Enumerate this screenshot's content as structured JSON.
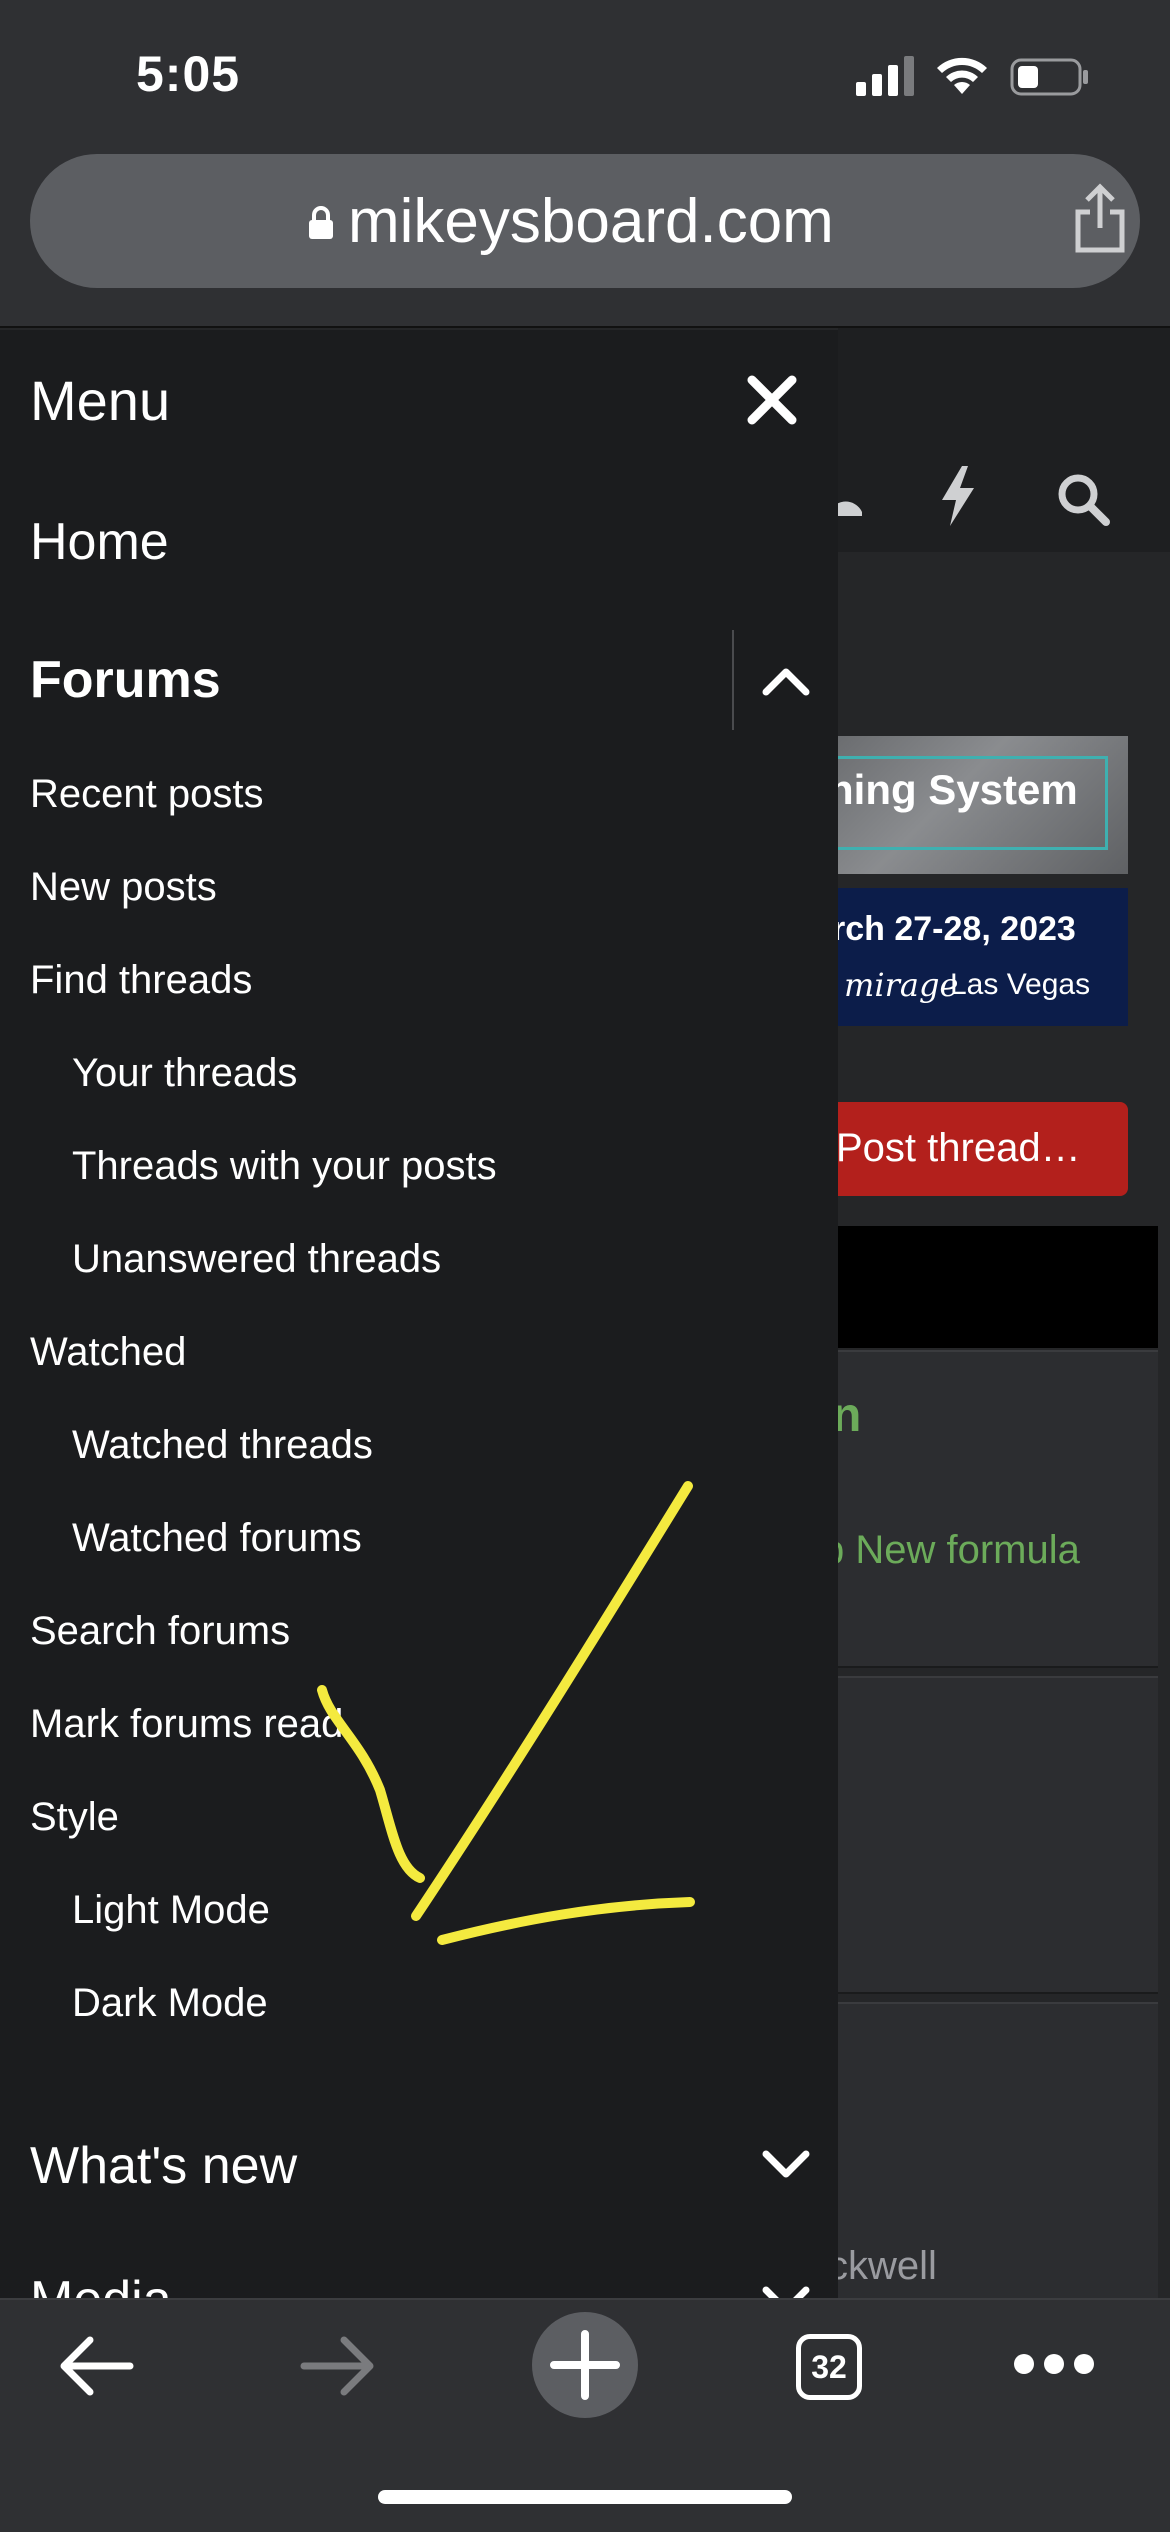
{
  "status": {
    "time": "5:05"
  },
  "browser": {
    "url": "mikeysboard.com",
    "tab_count": "32"
  },
  "background_page": {
    "banner1_text": "ning System",
    "banner2_line1": "rch 27-28, 2023",
    "banner2_line2": "Las Vegas",
    "banner2_logo": "mirage",
    "post_thread_button": "Post thread…",
    "card1_title_fragment": "n",
    "card1_text": "p New formula",
    "card3_text": "ckwell"
  },
  "menu": {
    "title": "Menu",
    "home": "Home",
    "forums": "Forums",
    "items": {
      "recent_posts": "Recent posts",
      "new_posts": "New posts",
      "find_threads": "Find threads",
      "your_threads": "Your threads",
      "threads_with_your_posts": "Threads with your posts",
      "unanswered_threads": "Unanswered threads",
      "watched": "Watched",
      "watched_threads": "Watched threads",
      "watched_forums": "Watched forums",
      "search_forums": "Search forums",
      "mark_forums_read": "Mark forums read",
      "style": "Style",
      "light_mode": "Light Mode",
      "dark_mode": "Dark Mode"
    },
    "whats_new": "What's new",
    "media": "Media"
  },
  "colors": {
    "annotation": "#f4ea3f",
    "post_button": "#b3201c",
    "green_link": "#6cab5a"
  }
}
